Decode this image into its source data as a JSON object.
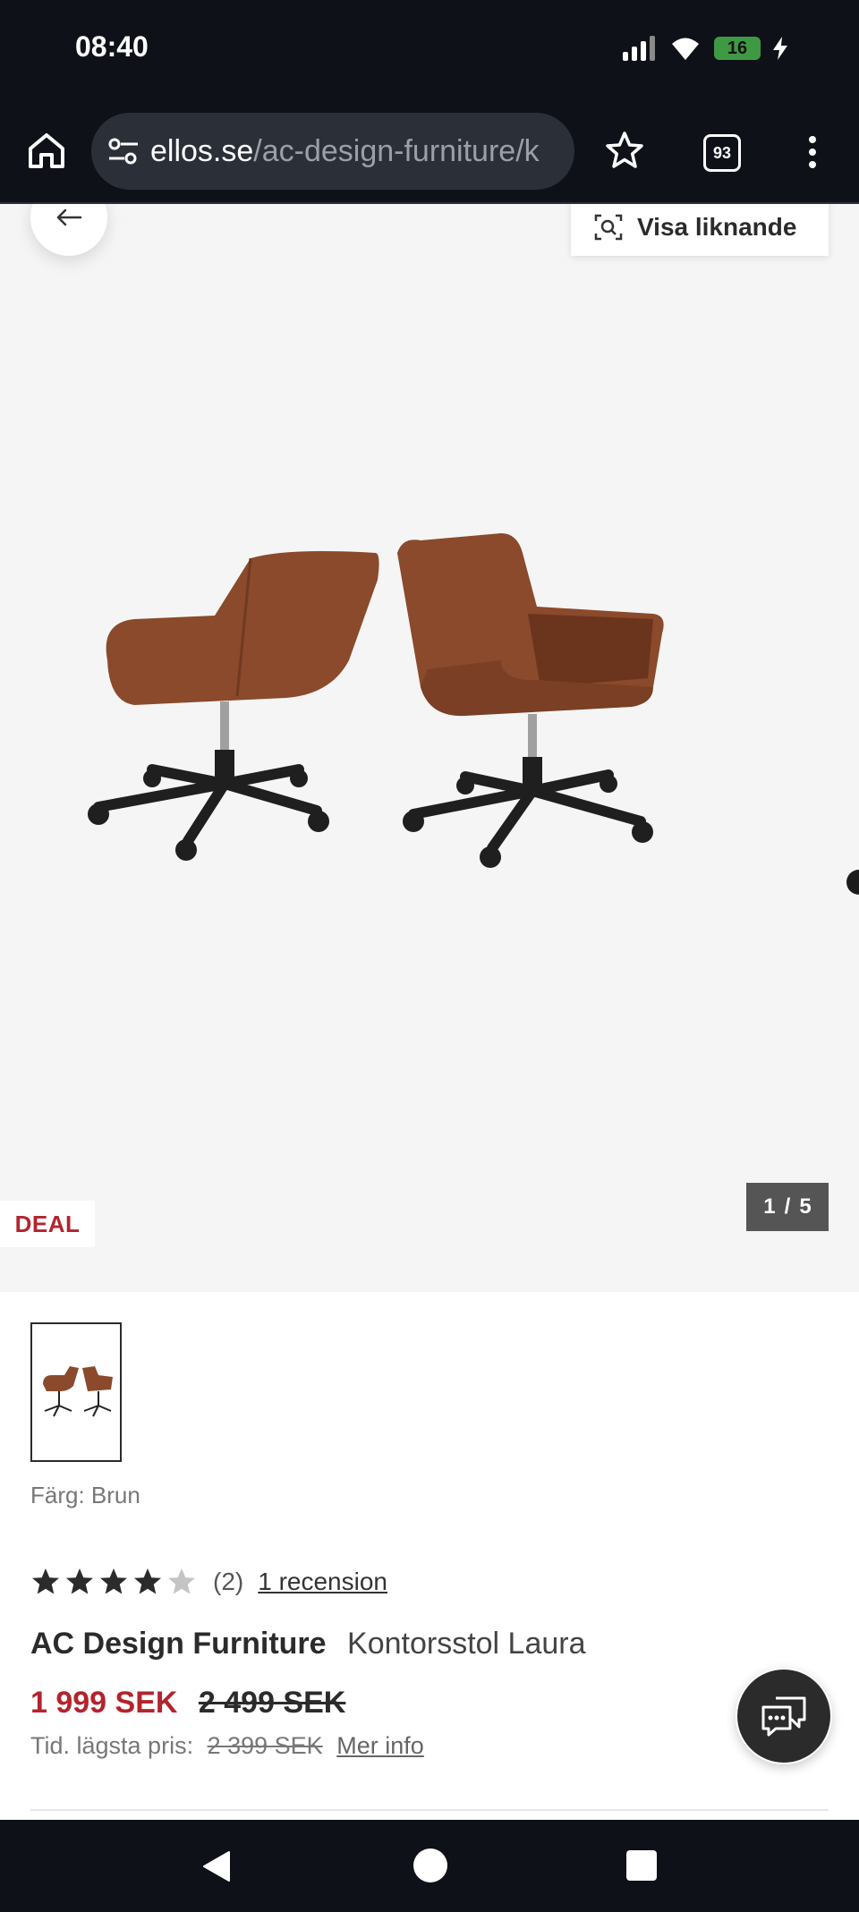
{
  "status_bar": {
    "time": "08:40",
    "battery": "16",
    "icons": [
      "signal-icon",
      "wifi-icon",
      "battery-icon",
      "charging-icon"
    ]
  },
  "browser": {
    "url_host": "ellos.se",
    "url_path": "/ac-design-furniture/k",
    "tab_count": "93",
    "icons": [
      "home-icon",
      "tune-icon",
      "bookmark-star-icon",
      "tabs-icon",
      "more-vert-icon"
    ]
  },
  "hero": {
    "similar_label": "Visa liknande",
    "deal_badge": "DEAL",
    "image_index": "1",
    "image_separator": "/",
    "image_total": "5",
    "image_position": 1
  },
  "product": {
    "color_label": "Färg: Brun",
    "rating": 4,
    "rating_max": 5,
    "review_count": "(2)",
    "review_link": "1 recension",
    "brand": "AC Design Furniture",
    "name": "Kontorsstol Laura",
    "price_now": "1 999 SEK",
    "price_old": "2 499 SEK",
    "lowest_label": "Tid. lägsta pris:",
    "lowest_price": "2 399 SEK",
    "more_info": "Mer info"
  },
  "colors": {
    "accent_red": "#b3242d",
    "chair_leather": "#8a4a2b",
    "dark": "#0e1117"
  }
}
